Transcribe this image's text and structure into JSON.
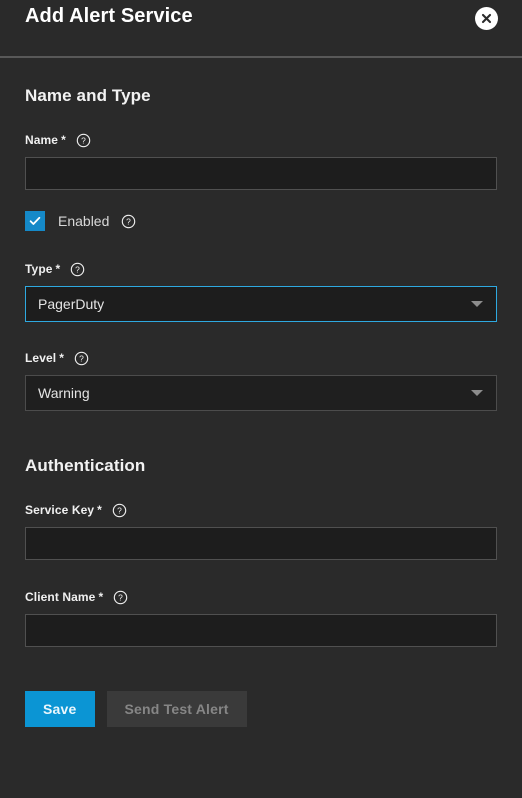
{
  "header": {
    "title": "Add Alert Service",
    "close_icon": "close-icon"
  },
  "sections": {
    "name_and_type": {
      "heading": "Name and Type",
      "name_field": {
        "label": "Name",
        "required_marker": "*",
        "value": "",
        "placeholder": "",
        "help_icon": "help-circle-icon"
      },
      "enabled_checkbox": {
        "label": "Enabled",
        "checked": true,
        "help_icon": "help-circle-icon",
        "accent_color": "#1589c8"
      },
      "type_select": {
        "label": "Type",
        "required_marker": "*",
        "value": "PagerDuty",
        "focused": true,
        "focus_color": "#2ea9e0",
        "help_icon": "help-circle-icon",
        "arrow_icon": "chevron-down-icon"
      },
      "level_select": {
        "label": "Level",
        "required_marker": "*",
        "value": "Warning",
        "focused": false,
        "help_icon": "help-circle-icon",
        "arrow_icon": "chevron-down-icon"
      }
    },
    "authentication": {
      "heading": "Authentication",
      "service_key_field": {
        "label": "Service Key",
        "required_marker": "*",
        "value": "",
        "placeholder": "",
        "help_icon": "help-circle-icon"
      },
      "client_name_field": {
        "label": "Client Name",
        "required_marker": "*",
        "value": "",
        "placeholder": "",
        "help_icon": "help-circle-icon"
      }
    }
  },
  "actions": {
    "save_label": "Save",
    "save_color": "#0b95d4",
    "send_test_label": "Send Test Alert",
    "send_test_disabled": true
  }
}
